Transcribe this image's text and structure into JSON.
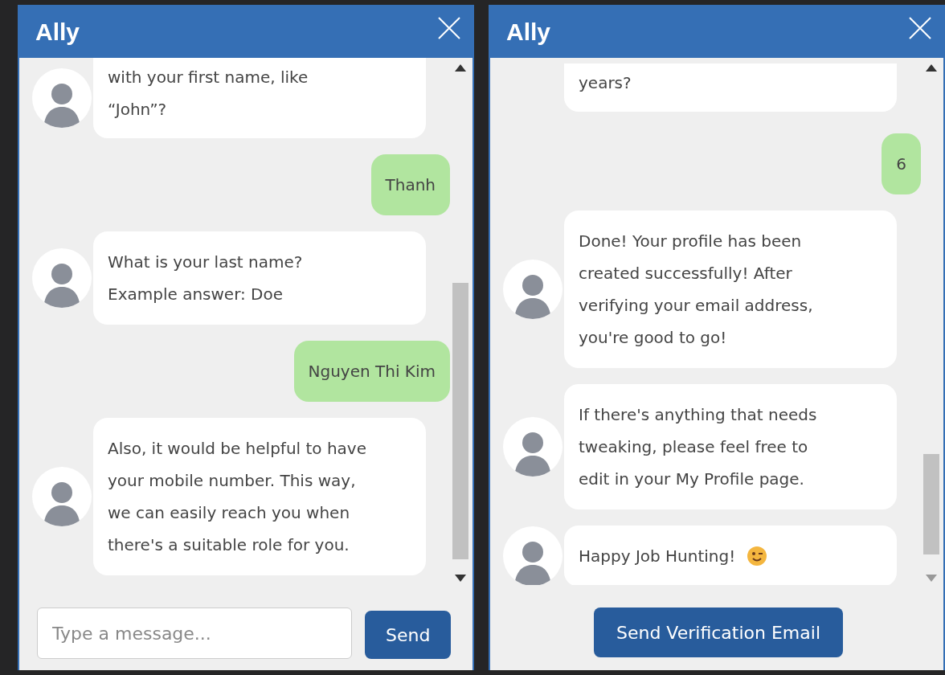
{
  "windows": [
    {
      "title": "Ally",
      "messages": [
        {
          "kind": "bot",
          "cut_top": true,
          "text": "with your first name, like\n“John”?"
        },
        {
          "kind": "user",
          "text": "Thanh"
        },
        {
          "kind": "bot",
          "text": "What is your last name?\nExample answer: Doe"
        },
        {
          "kind": "user",
          "text": "Nguyen Thi Kim"
        },
        {
          "kind": "bot",
          "text": "Also, it would be helpful to have\nyour mobile number. This way,\nwe can easily reach you when\nthere's a suitable role for you."
        }
      ],
      "footer": {
        "kind": "composer",
        "placeholder": "Type a message...",
        "button": "Send"
      }
    },
    {
      "title": "Ally",
      "messages": [
        {
          "kind": "bot",
          "cut_top": true,
          "no_avatar": true,
          "text": "years?"
        },
        {
          "kind": "user",
          "text": "6"
        },
        {
          "kind": "bot",
          "text": "Done! Your profile has been\ncreated successfully! After\nverifying your email address,\nyou're good to go!"
        },
        {
          "kind": "bot",
          "text": "If there's anything that needs\ntweaking, please feel free to\nedit in your My Profile page."
        },
        {
          "kind": "bot_wink",
          "text": "Happy Job Hunting!"
        }
      ],
      "footer": {
        "kind": "action",
        "button": "Send Verification Email"
      }
    }
  ]
}
